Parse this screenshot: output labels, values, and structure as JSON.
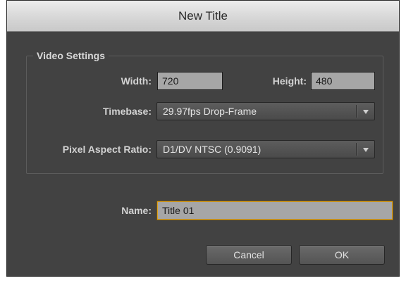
{
  "dialog": {
    "title": "New Title"
  },
  "video_settings": {
    "legend": "Video Settings",
    "width_label": "Width:",
    "width_value": "720",
    "height_label": "Height:",
    "height_value": "480",
    "timebase_label": "Timebase:",
    "timebase_value": "29.97fps Drop-Frame",
    "par_label": "Pixel Aspect Ratio:",
    "par_value": "D1/DV NTSC (0.9091)"
  },
  "name_field": {
    "label": "Name:",
    "value": "Title 01"
  },
  "buttons": {
    "cancel": "Cancel",
    "ok": "OK"
  },
  "icons": {
    "dropdown": "triangle-down-icon"
  },
  "colors": {
    "panel_bg": "#424242",
    "field_bg": "#a6a6a6",
    "focus_ring": "#e0a21a"
  }
}
